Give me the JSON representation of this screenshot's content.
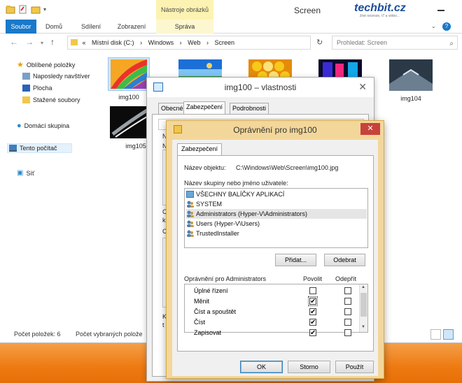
{
  "explorer": {
    "title": "Screen",
    "tools_tab": "Nástroje obrázků",
    "brand": "techbit.cz",
    "brand_sub": "živé recenze, IT a video...",
    "ribbon_tabs": [
      "Soubor",
      "Domů",
      "Sdílení",
      "Zobrazení",
      "Správa"
    ],
    "address": [
      "«",
      "Místní disk (C:)",
      "›",
      "Windows",
      "›",
      "Web",
      "›",
      "Screen"
    ],
    "search_placeholder": "Prohledat: Screen",
    "nav": {
      "favorites": "Oblíbené položky",
      "recent": "Naposledy navštíver",
      "desktop": "Plocha",
      "downloads": "Stažené soubory",
      "homegroup": "Domácí skupina",
      "thispc": "Tento počítač",
      "network": "Síť"
    },
    "files": [
      {
        "name": "img100",
        "colors": [
          "#e9332b",
          "#f5a623",
          "#3bbd4a",
          "#2c7fd2",
          "#9b3fb5"
        ]
      },
      {
        "name": "",
        "colors": [
          "#1b6fd6",
          "#7ec3f5",
          "#f4d35e",
          "#2f8d2f"
        ]
      },
      {
        "name": "",
        "colors": [
          "#f8c81c",
          "#e58b0a",
          "#fbe27a"
        ]
      },
      {
        "name": "",
        "colors": [
          "#3b2bd6",
          "#f2287f",
          "#13a6e8",
          "#090a2b"
        ]
      },
      {
        "name": "img104",
        "colors": [
          "#6b7f91",
          "#dfe8ef",
          "#2b3947"
        ]
      },
      {
        "name": "img105",
        "colors": [
          "#0b0b0b",
          "#9aa1a6",
          "#f1f1f1"
        ]
      }
    ],
    "status_count": "Počet položek: 6",
    "status_selected": "Počet vybraných polože"
  },
  "properties": {
    "title": "img100 – vlastnosti",
    "tabs": [
      "Obecné",
      "Zabezpečení",
      "Podrobnosti"
    ],
    "fragments": [
      "N",
      "N",
      "C",
      "k",
      "C",
      "K",
      "t"
    ]
  },
  "permissions": {
    "title": "Oprávnění pro img100",
    "tab": "Zabezpečení",
    "object_label": "Název objektu:",
    "object_value": "C:\\Windows\\Web\\Screen\\img100.jpg",
    "group_label": "Název skupiny nebo jméno uživatele:",
    "users": [
      "VŠECHNY BALÍČKY APLIKACÍ",
      "SYSTEM",
      "Administrators (Hyper-V\\Administrators)",
      "Users (Hyper-V\\Users)",
      "TrustedInstaller"
    ],
    "selected_user_index": 2,
    "add_button": "Přidat...",
    "remove_button": "Odebrat",
    "perm_for_label": "Oprávnění pro Administrators",
    "allow_header": "Povolit",
    "deny_header": "Odepřít",
    "perms": [
      {
        "name": "Úplné řízení",
        "allow": false,
        "deny": false
      },
      {
        "name": "Měnit",
        "allow": true,
        "deny": false
      },
      {
        "name": "Číst a spouštět",
        "allow": true,
        "deny": false
      },
      {
        "name": "Číst",
        "allow": true,
        "deny": false
      },
      {
        "name": "Zapisovat",
        "allow": true,
        "deny": false
      }
    ],
    "ok_button": "OK",
    "cancel_button": "Storno",
    "apply_button": "Použít"
  }
}
